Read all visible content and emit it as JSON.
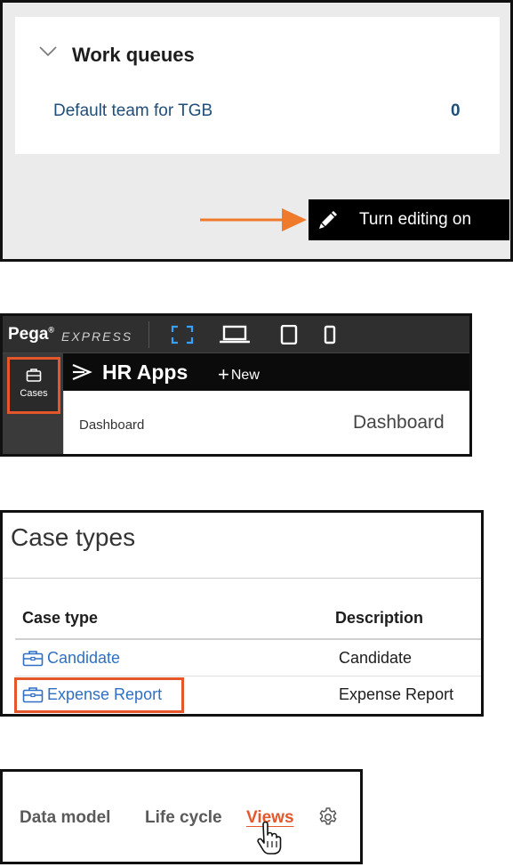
{
  "work_queues": {
    "title": "Work queues",
    "rows": [
      {
        "label": "Default team for TGB",
        "count": "0"
      }
    ],
    "edit_button": "Turn editing on"
  },
  "studio": {
    "brand": "Pega",
    "brand_reg": "®",
    "brand_sub": "EXPRESS",
    "sidebar_cases": "Cases",
    "app_title": "HR Apps",
    "new_label": "New",
    "nav_item": "Dashboard",
    "page_heading": "Dashboard"
  },
  "case_types": {
    "title": "Case types",
    "columns": [
      "Case type",
      "Description"
    ],
    "rows": [
      {
        "name": "Candidate",
        "description": "Candidate"
      },
      {
        "name": "Expense Report",
        "description": "Expense Report"
      }
    ]
  },
  "tabs": {
    "items": [
      "Data model",
      "Life cycle",
      "Views"
    ],
    "active": "Views"
  },
  "colors": {
    "accent": "#e5572b",
    "link": "#2f6fc4",
    "queue_text": "#1f4e79"
  }
}
